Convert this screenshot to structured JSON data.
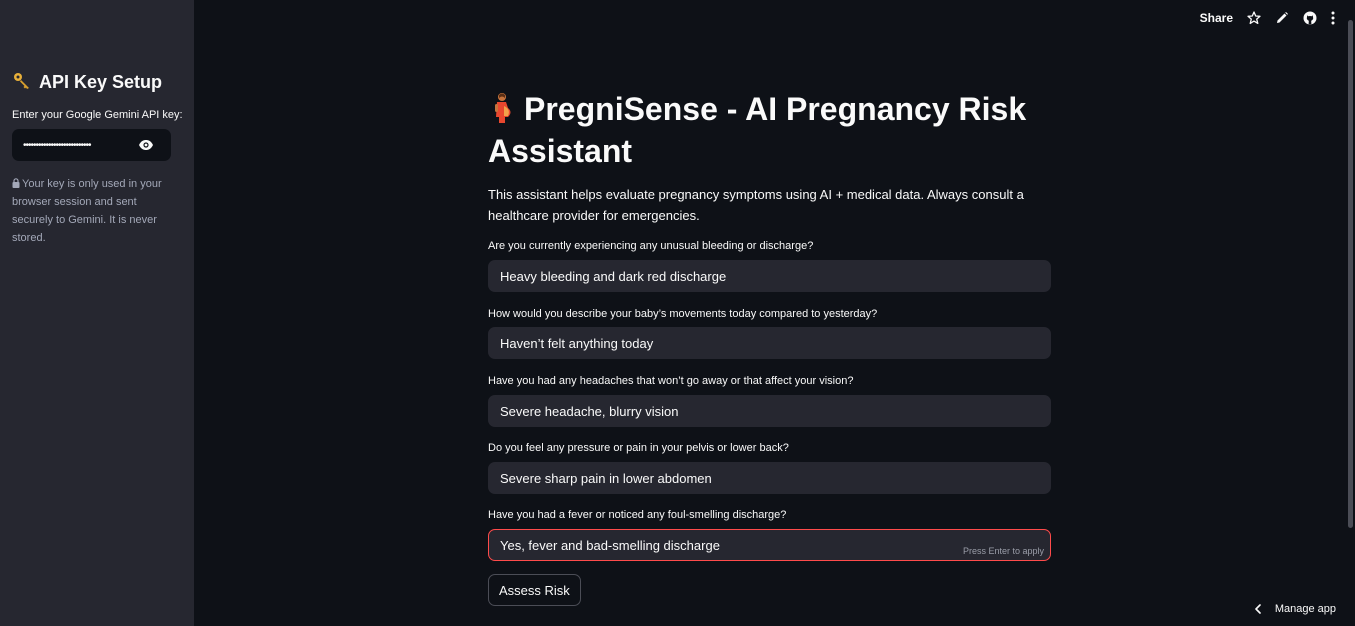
{
  "sidebar": {
    "title": "API Key Setup",
    "title_icon": "key-icon",
    "api_key_label": "Enter your Google Gemini API key:",
    "api_key_value": "•••••••••••••••••••••••••••",
    "note": "Your key is only used in your browser session and sent securely to Gemini. It is never stored."
  },
  "toolbar": {
    "share_label": "Share",
    "icons": [
      "star-icon",
      "pencil-icon",
      "github-icon",
      "kebab-menu-icon"
    ]
  },
  "main": {
    "title": "PregniSense - AI Pregnancy Risk Assistant",
    "title_icon": "pregnant-woman-icon",
    "description": "This assistant helps evaluate pregnancy symptoms using AI + medical data. Always consult a healthcare provider for emergencies.",
    "questions": [
      {
        "label": "Are you currently experiencing any unusual bleeding or discharge?",
        "value": "Heavy bleeding and dark red discharge"
      },
      {
        "label": "How would you describe your baby’s movements today compared to yesterday?",
        "value": "Haven’t felt anything today"
      },
      {
        "label": "Have you had any headaches that won’t go away or that affect your vision?",
        "value": "Severe headache, blurry vision"
      },
      {
        "label": "Do you feel any pressure or pain in your pelvis or lower back?",
        "value": "Severe sharp pain in lower abdomen"
      },
      {
        "label": "Have you had a fever or noticed any foul-smelling discharge?",
        "value": "Yes, fever and bad-smelling discharge"
      }
    ],
    "input_hint": "Press Enter to apply",
    "assess_button": "Assess Risk"
  },
  "footer": {
    "manage_app": "Manage app"
  },
  "colors": {
    "background": "#0e1117",
    "sidebar": "#262730",
    "input": "#262730",
    "focus_border": "#ff4b4b",
    "muted_text": "#a3a8b8"
  }
}
